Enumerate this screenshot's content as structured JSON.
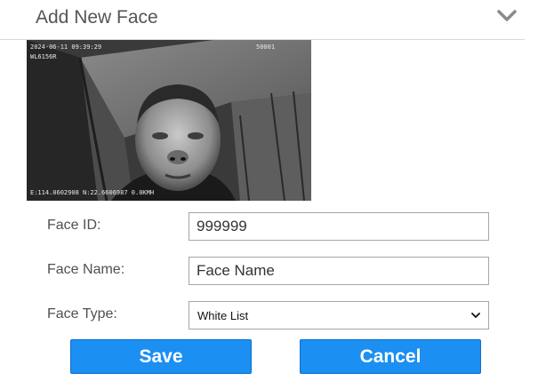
{
  "header": {
    "title": "Add New Face",
    "collapse_icon": "chevron-down-icon"
  },
  "snapshot": {
    "timestamp": "2024-06-11 09:39:29",
    "device": "WL6156R",
    "channel": "50001",
    "coordinates": "E:114.0602908 N:22.6606987 0.0KMH"
  },
  "form": {
    "face_id": {
      "label": "Face ID:",
      "value": "999999"
    },
    "face_name": {
      "label": "Face Name:",
      "value": "Face Name"
    },
    "face_type": {
      "label": "Face Type:",
      "selected": "White List"
    }
  },
  "buttons": {
    "save": "Save",
    "cancel": "Cancel"
  },
  "colors": {
    "button_blue": "#1b8ff2",
    "title_gray": "#555555"
  }
}
